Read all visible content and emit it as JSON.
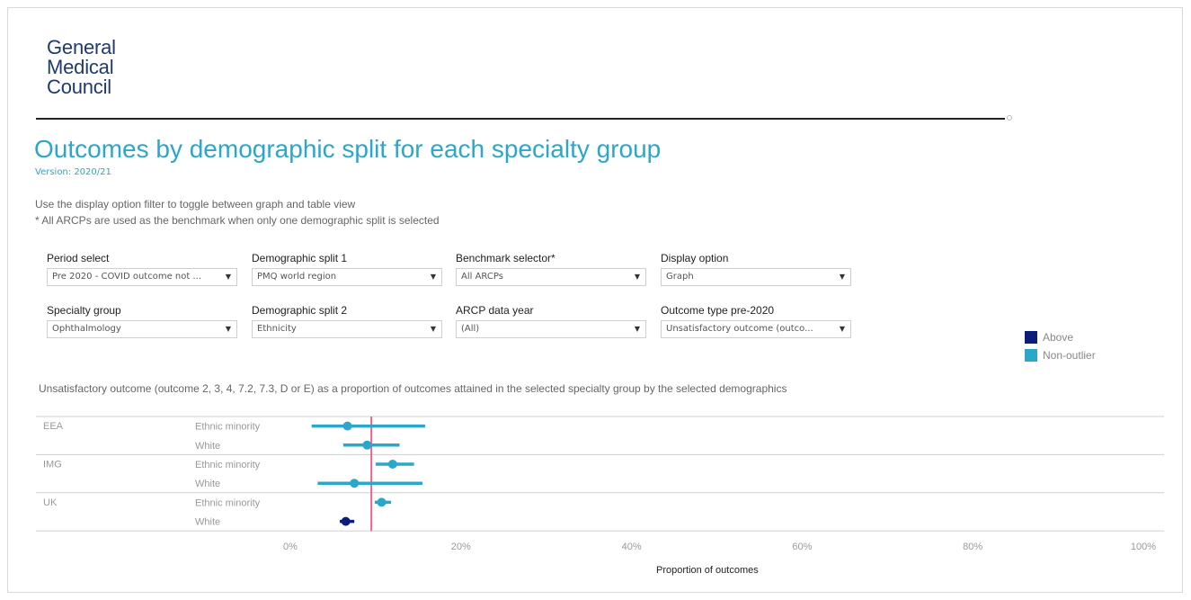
{
  "logo": {
    "line1": "General",
    "line2": "Medical",
    "line3": "Council"
  },
  "header": {
    "title": "Outcomes by demographic split for each specialty group",
    "version": "Version: 2020/21",
    "instruction1": "Use the display option filter to toggle between graph and table view",
    "instruction2": "* All ARCPs are used as the benchmark when only one demographic split is selected"
  },
  "filters": [
    {
      "label": "Period select",
      "value": "Pre 2020 - COVID outcome not ..."
    },
    {
      "label": "Demographic split 1",
      "value": "PMQ world region"
    },
    {
      "label": "Benchmark selector*",
      "value": "All ARCPs"
    },
    {
      "label": "Display option",
      "value": "Graph"
    },
    {
      "label": "Specialty group",
      "value": "Ophthalmology"
    },
    {
      "label": "Demographic split 2",
      "value": "Ethnicity"
    },
    {
      "label": "ARCP data year",
      "value": "(All)"
    },
    {
      "label": "Outcome type pre-2020",
      "value": "Unsatisfactory outcome (outco..."
    }
  ],
  "legend": [
    {
      "label": "Above",
      "color": "#0b1f7a"
    },
    {
      "label": "Non-outlier",
      "color": "#2aa7c9"
    }
  ],
  "chart_subtitle": "Unsatisfactory outcome (outcome 2, 3, 4, 7.2, 7.3, D or E) as a proportion of outcomes attained in the selected specialty group by the selected demographics",
  "chart_data": {
    "type": "scatter",
    "xlabel": "Proportion of outcomes",
    "xlim": [
      0,
      1
    ],
    "xticks": [
      "0%",
      "20%",
      "40%",
      "60%",
      "80%",
      "100%"
    ],
    "xtick_values": [
      0,
      0.2,
      0.4,
      0.6,
      0.8,
      1.0
    ],
    "benchmark": 0.095,
    "benchmark_color": "#e8658c",
    "groups": [
      "EEA",
      "IMG",
      "UK"
    ],
    "rows": [
      {
        "group": "EEA",
        "label": "Ethnic minority",
        "value": 0.067,
        "low": 0.025,
        "high": 0.158,
        "status": "Non-outlier"
      },
      {
        "group": "EEA",
        "label": "White",
        "value": 0.09,
        "low": 0.062,
        "high": 0.128,
        "status": "Non-outlier"
      },
      {
        "group": "IMG",
        "label": "Ethnic minority",
        "value": 0.12,
        "low": 0.1,
        "high": 0.145,
        "status": "Non-outlier"
      },
      {
        "group": "IMG",
        "label": "White",
        "value": 0.075,
        "low": 0.032,
        "high": 0.155,
        "status": "Non-outlier"
      },
      {
        "group": "UK",
        "label": "Ethnic minority",
        "value": 0.107,
        "low": 0.099,
        "high": 0.118,
        "status": "Non-outlier"
      },
      {
        "group": "UK",
        "label": "White",
        "value": 0.065,
        "low": 0.058,
        "high": 0.075,
        "status": "Above"
      }
    ]
  }
}
